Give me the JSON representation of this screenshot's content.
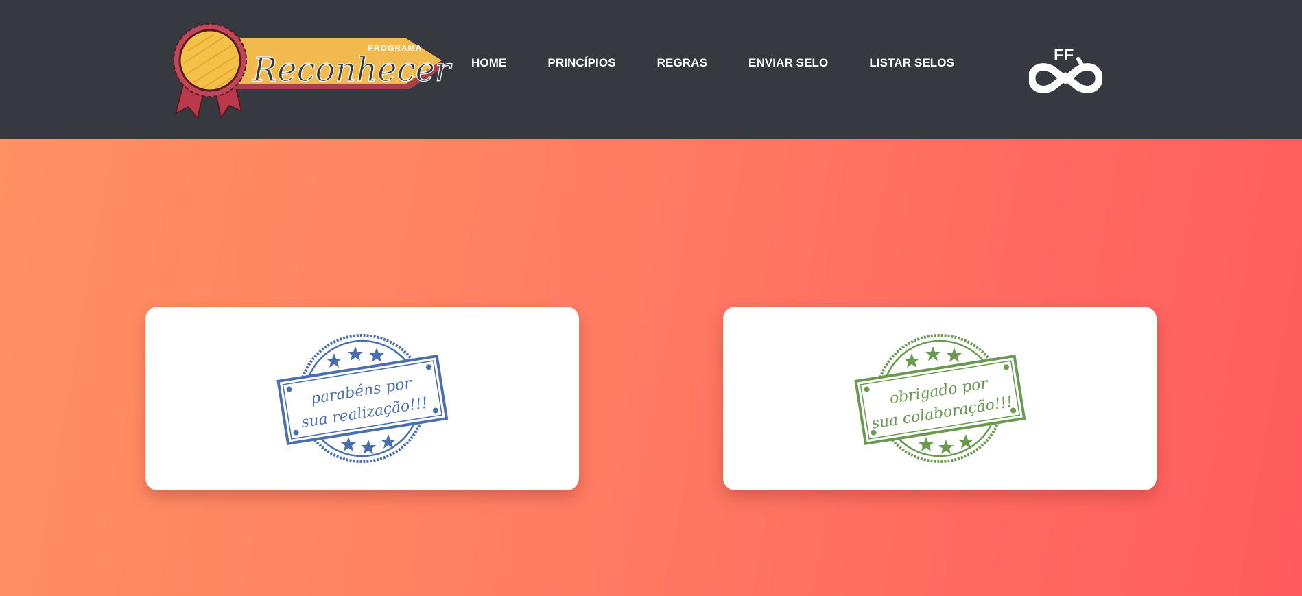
{
  "brand": {
    "logo_small_text": "PROGRAMA",
    "logo_main_text": "Reconhecer",
    "partner_logo_text": "FF"
  },
  "nav": {
    "items": [
      {
        "label": "HOME"
      },
      {
        "label": "PRINCÍPIOS"
      },
      {
        "label": "REGRAS"
      },
      {
        "label": "ENVIAR SELO"
      },
      {
        "label": "LISTAR SELOS"
      }
    ]
  },
  "cards": [
    {
      "stamp_line1": "parabéns por",
      "stamp_line2": "sua realização!!!",
      "color": "#4a6fb0"
    },
    {
      "stamp_line1": "obrigado por",
      "stamp_line2": "sua colaboração!!!",
      "color": "#6a9a50"
    }
  ],
  "colors": {
    "header_bg": "#363940",
    "gradient_start": "#ff9163",
    "gradient_end": "#ff5c5f",
    "logo_banner": "#f2b94e",
    "logo_medal": "#b83a4b"
  }
}
